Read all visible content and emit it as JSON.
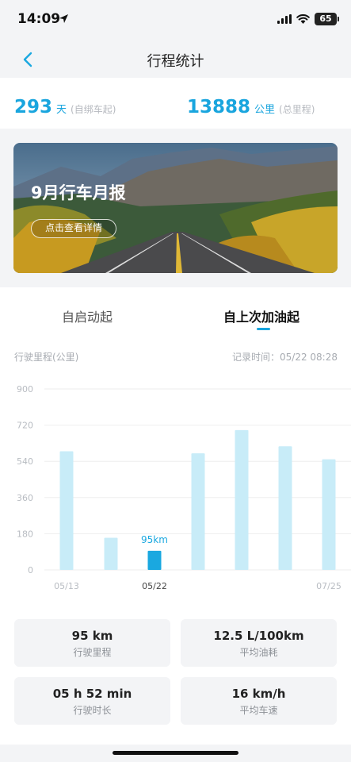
{
  "status_bar": {
    "time": "14:09",
    "battery": "65"
  },
  "nav": {
    "title": "行程统计"
  },
  "summary": {
    "days": {
      "value": "293",
      "unit": "天",
      "note": "(自绑车起)"
    },
    "mileage": {
      "value": "13888",
      "unit": "公里",
      "note": "(总里程)"
    }
  },
  "banner": {
    "title": "9月行车月报",
    "button": "点击查看详情"
  },
  "tabs": [
    {
      "label": "自启动起",
      "active": false
    },
    {
      "label": "自上次加油起",
      "active": true
    }
  ],
  "chart_header": {
    "label": "行驶里程(公里)",
    "record_time": "记录时间：05/22 08:28"
  },
  "chart_data": {
    "type": "bar",
    "ylim": [
      0,
      900
    ],
    "yticks": [
      "900",
      "720",
      "540",
      "360",
      "180",
      "0"
    ],
    "values": [
      590,
      160,
      95,
      580,
      695,
      615,
      550
    ],
    "highlight_index": 2,
    "highlight_label": "95km",
    "x_labels": [
      "05/13",
      "05/22",
      "07/25"
    ],
    "colors": {
      "bar": "#c8ecf8",
      "highlight": "#1aa8e0",
      "grid": "#eeeeee"
    }
  },
  "stats": [
    {
      "value": "95 km",
      "label": "行驶里程"
    },
    {
      "value": "12.5 L/100km",
      "label": "平均油耗"
    },
    {
      "value": "05 h 52 min",
      "label": "行驶时长"
    },
    {
      "value": "16 km/h",
      "label": "平均车速"
    }
  ]
}
